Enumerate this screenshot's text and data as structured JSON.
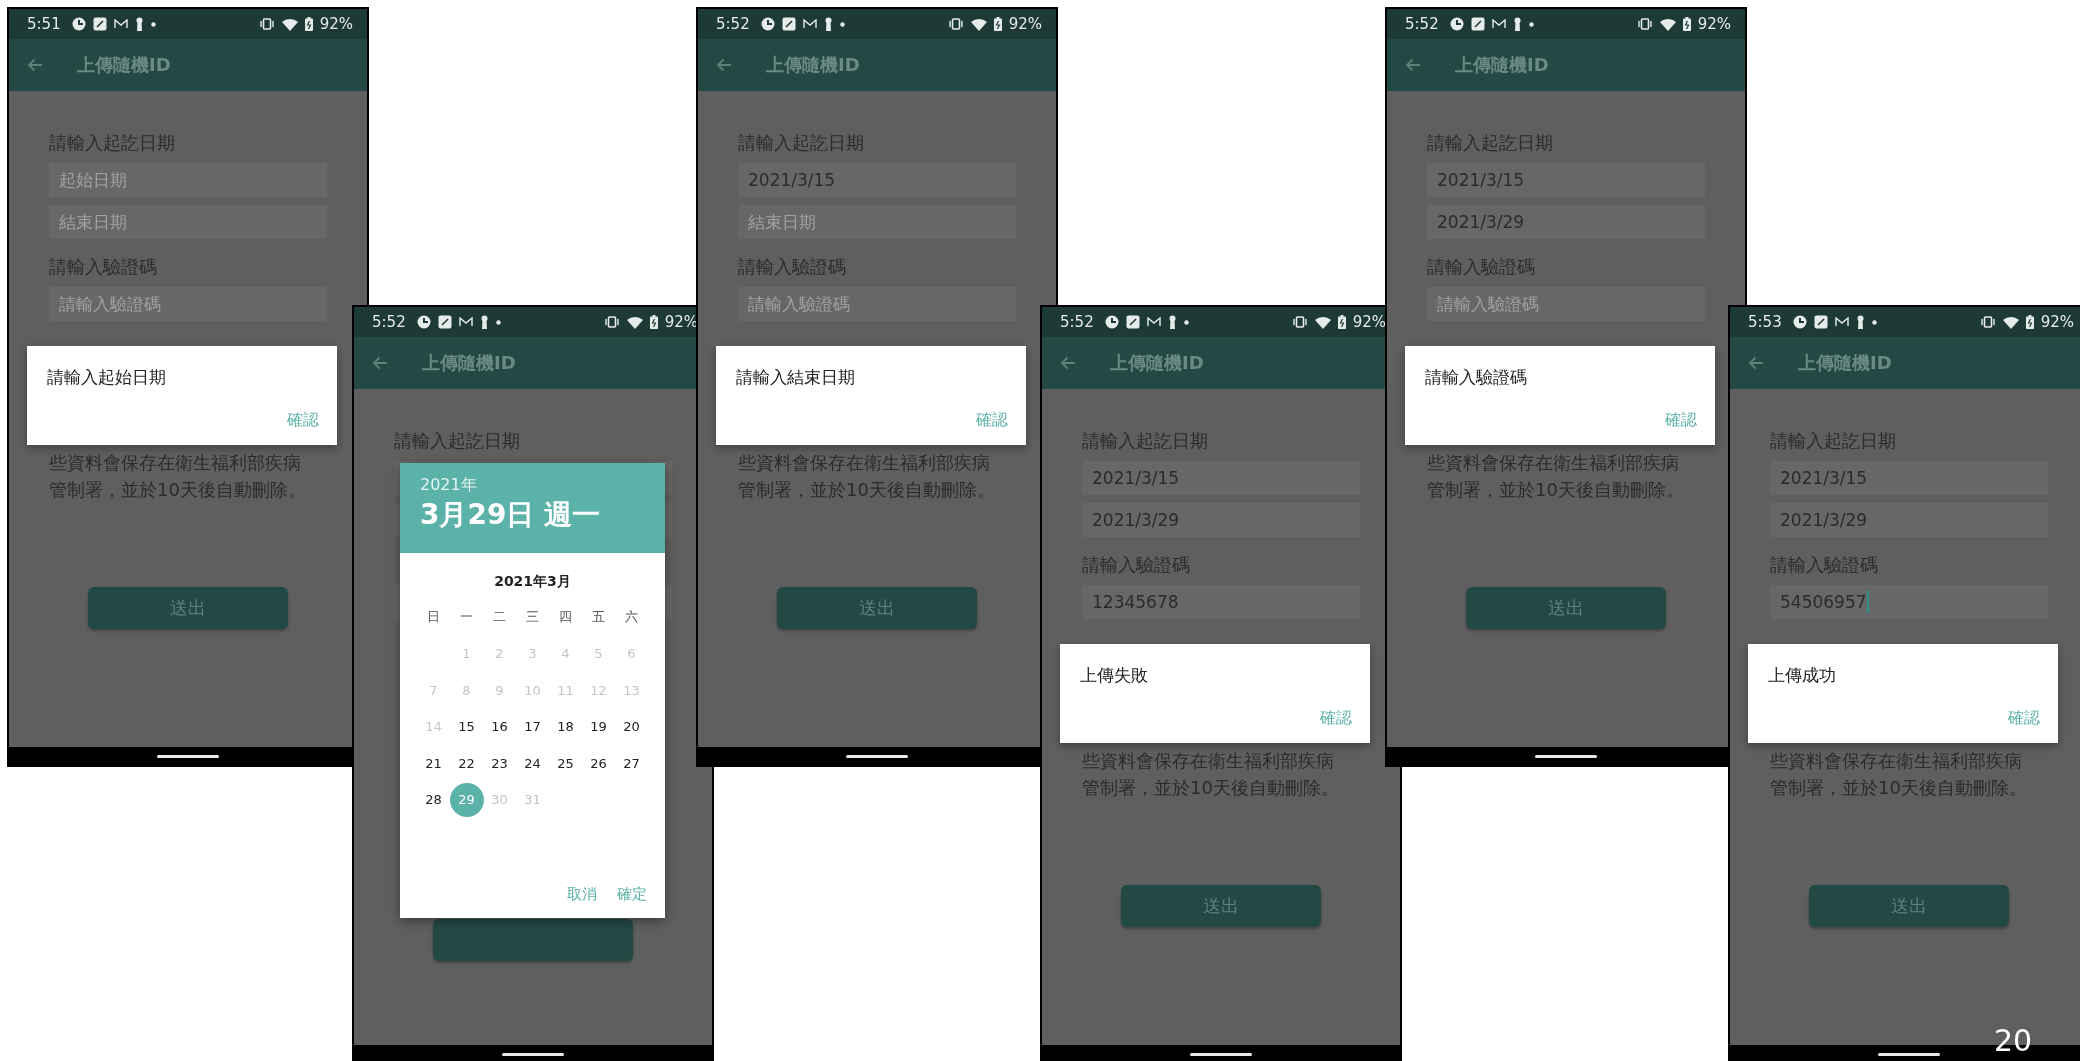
{
  "phones": [
    {
      "status": {
        "time": "5:51",
        "battery": "92%"
      },
      "app_bar": {
        "title": "上傳隨機ID"
      },
      "form": {
        "date_label": "請輸入起訖日期",
        "start_field": {
          "placeholder": "起始日期"
        },
        "end_field": {
          "placeholder": "結束日期"
        },
        "code_label": "請輸入驗證碼",
        "code_field": {
          "placeholder": "請輸入驗證碼"
        },
        "notice_lines": [
          "些資料會保存在衛生福利部疾病",
          "管制署，並於10天後自動刪除。"
        ],
        "submit_button": "送出"
      },
      "dialog": {
        "kind": "alert",
        "message": "請輸入起始日期",
        "button": "確認"
      }
    },
    {
      "status": {
        "time": "5:52",
        "battery": "92%"
      },
      "app_bar": {
        "title": "上傳隨機ID"
      },
      "form": {
        "date_label": "請輸入起訖日期"
      },
      "dialog": {
        "kind": "date_picker",
        "year": "2021年",
        "date": "3月29日 週一",
        "month": "2021年3月",
        "weekdays": [
          "日",
          "一",
          "二",
          "三",
          "四",
          "五",
          "六"
        ],
        "days": [
          {
            "label": "1",
            "disabled": true,
            "selected": false
          },
          {
            "label": "2",
            "disabled": true,
            "selected": false
          },
          {
            "label": "3",
            "disabled": true,
            "selected": false
          },
          {
            "label": "4",
            "disabled": true,
            "selected": false
          },
          {
            "label": "5",
            "disabled": true,
            "selected": false
          },
          {
            "label": "6",
            "disabled": true,
            "selected": false
          },
          {
            "label": "7",
            "disabled": true,
            "selected": false
          },
          {
            "label": "8",
            "disabled": true,
            "selected": false
          },
          {
            "label": "9",
            "disabled": true,
            "selected": false
          },
          {
            "label": "10",
            "disabled": true,
            "selected": false
          },
          {
            "label": "11",
            "disabled": true,
            "selected": false
          },
          {
            "label": "12",
            "disabled": true,
            "selected": false
          },
          {
            "label": "13",
            "disabled": true,
            "selected": false
          },
          {
            "label": "14",
            "disabled": true,
            "selected": false
          },
          {
            "label": "15",
            "disabled": false,
            "selected": false
          },
          {
            "label": "16",
            "disabled": false,
            "selected": false
          },
          {
            "label": "17",
            "disabled": false,
            "selected": false
          },
          {
            "label": "18",
            "disabled": false,
            "selected": false
          },
          {
            "label": "19",
            "disabled": false,
            "selected": false
          },
          {
            "label": "20",
            "disabled": false,
            "selected": false
          },
          {
            "label": "21",
            "disabled": false,
            "selected": false
          },
          {
            "label": "22",
            "disabled": false,
            "selected": false
          },
          {
            "label": "23",
            "disabled": false,
            "selected": false
          },
          {
            "label": "24",
            "disabled": false,
            "selected": false
          },
          {
            "label": "25",
            "disabled": false,
            "selected": false
          },
          {
            "label": "26",
            "disabled": false,
            "selected": false
          },
          {
            "label": "27",
            "disabled": false,
            "selected": false
          },
          {
            "label": "28",
            "disabled": false,
            "selected": false
          },
          {
            "label": "29",
            "disabled": false,
            "selected": true
          },
          {
            "label": "30",
            "disabled": true,
            "selected": false
          },
          {
            "label": "31",
            "disabled": true,
            "selected": false
          }
        ],
        "buttons": [
          "取消",
          "確定"
        ]
      }
    },
    {
      "status": {
        "time": "5:52",
        "battery": "92%"
      },
      "app_bar": {
        "title": "上傳隨機ID"
      },
      "form": {
        "date_label": "請輸入起訖日期",
        "start_field": {
          "value": "2021/3/15"
        },
        "end_field": {
          "placeholder": "結束日期"
        },
        "code_label": "請輸入驗證碼",
        "code_field": {
          "placeholder": "請輸入驗證碼"
        },
        "notice_lines": [
          "些資料會保存在衛生福利部疾病",
          "管制署，並於10天後自動刪除。"
        ],
        "submit_button": "送出"
      },
      "dialog": {
        "kind": "alert",
        "message": "請輸入結束日期",
        "button": "確認"
      }
    },
    {
      "status": {
        "time": "5:52",
        "battery": "92%"
      },
      "app_bar": {
        "title": "上傳隨機ID"
      },
      "form": {
        "date_label": "請輸入起訖日期",
        "start_field": {
          "value": "2021/3/15"
        },
        "end_field": {
          "value": "2021/3/29"
        },
        "code_label": "請輸入驗證碼",
        "code_field": {
          "value": "12345678"
        },
        "notice_lines": [
          "些資料會保存在衛生福利部疾病",
          "管制署，並於10天後自動刪除。"
        ],
        "submit_button": "送出"
      },
      "dialog": {
        "kind": "alert",
        "message": "上傳失敗",
        "button": "確認"
      }
    },
    {
      "status": {
        "time": "5:52",
        "battery": "92%"
      },
      "app_bar": {
        "title": "上傳隨機ID"
      },
      "form": {
        "date_label": "請輸入起訖日期",
        "start_field": {
          "value": "2021/3/15"
        },
        "end_field": {
          "value": "2021/3/29"
        },
        "code_label": "請輸入驗證碼",
        "code_field": {
          "placeholder": "請輸入驗證碼"
        },
        "notice_lines": [
          "些資料會保存在衛生福利部疾病",
          "管制署，並於10天後自動刪除。"
        ],
        "submit_button": "送出"
      },
      "dialog": {
        "kind": "alert",
        "message": "請輸入驗證碼",
        "button": "確認"
      }
    },
    {
      "status": {
        "time": "5:53",
        "battery": "92%"
      },
      "app_bar": {
        "title": "上傳隨機ID"
      },
      "form": {
        "date_label": "請輸入起訖日期",
        "start_field": {
          "value": "2021/3/15"
        },
        "end_field": {
          "value": "2021/3/29"
        },
        "code_label": "請輸入驗證碼",
        "code_field": {
          "value": "54506957",
          "focused": true
        },
        "notice_lines": [
          "些資料會保存在衛生福利部疾病",
          "管制署，並於10天後自動刪除。"
        ],
        "submit_button": "送出"
      },
      "dialog": {
        "kind": "alert",
        "message": "上傳成功",
        "button": "確認"
      }
    }
  ],
  "slide_number": "20"
}
